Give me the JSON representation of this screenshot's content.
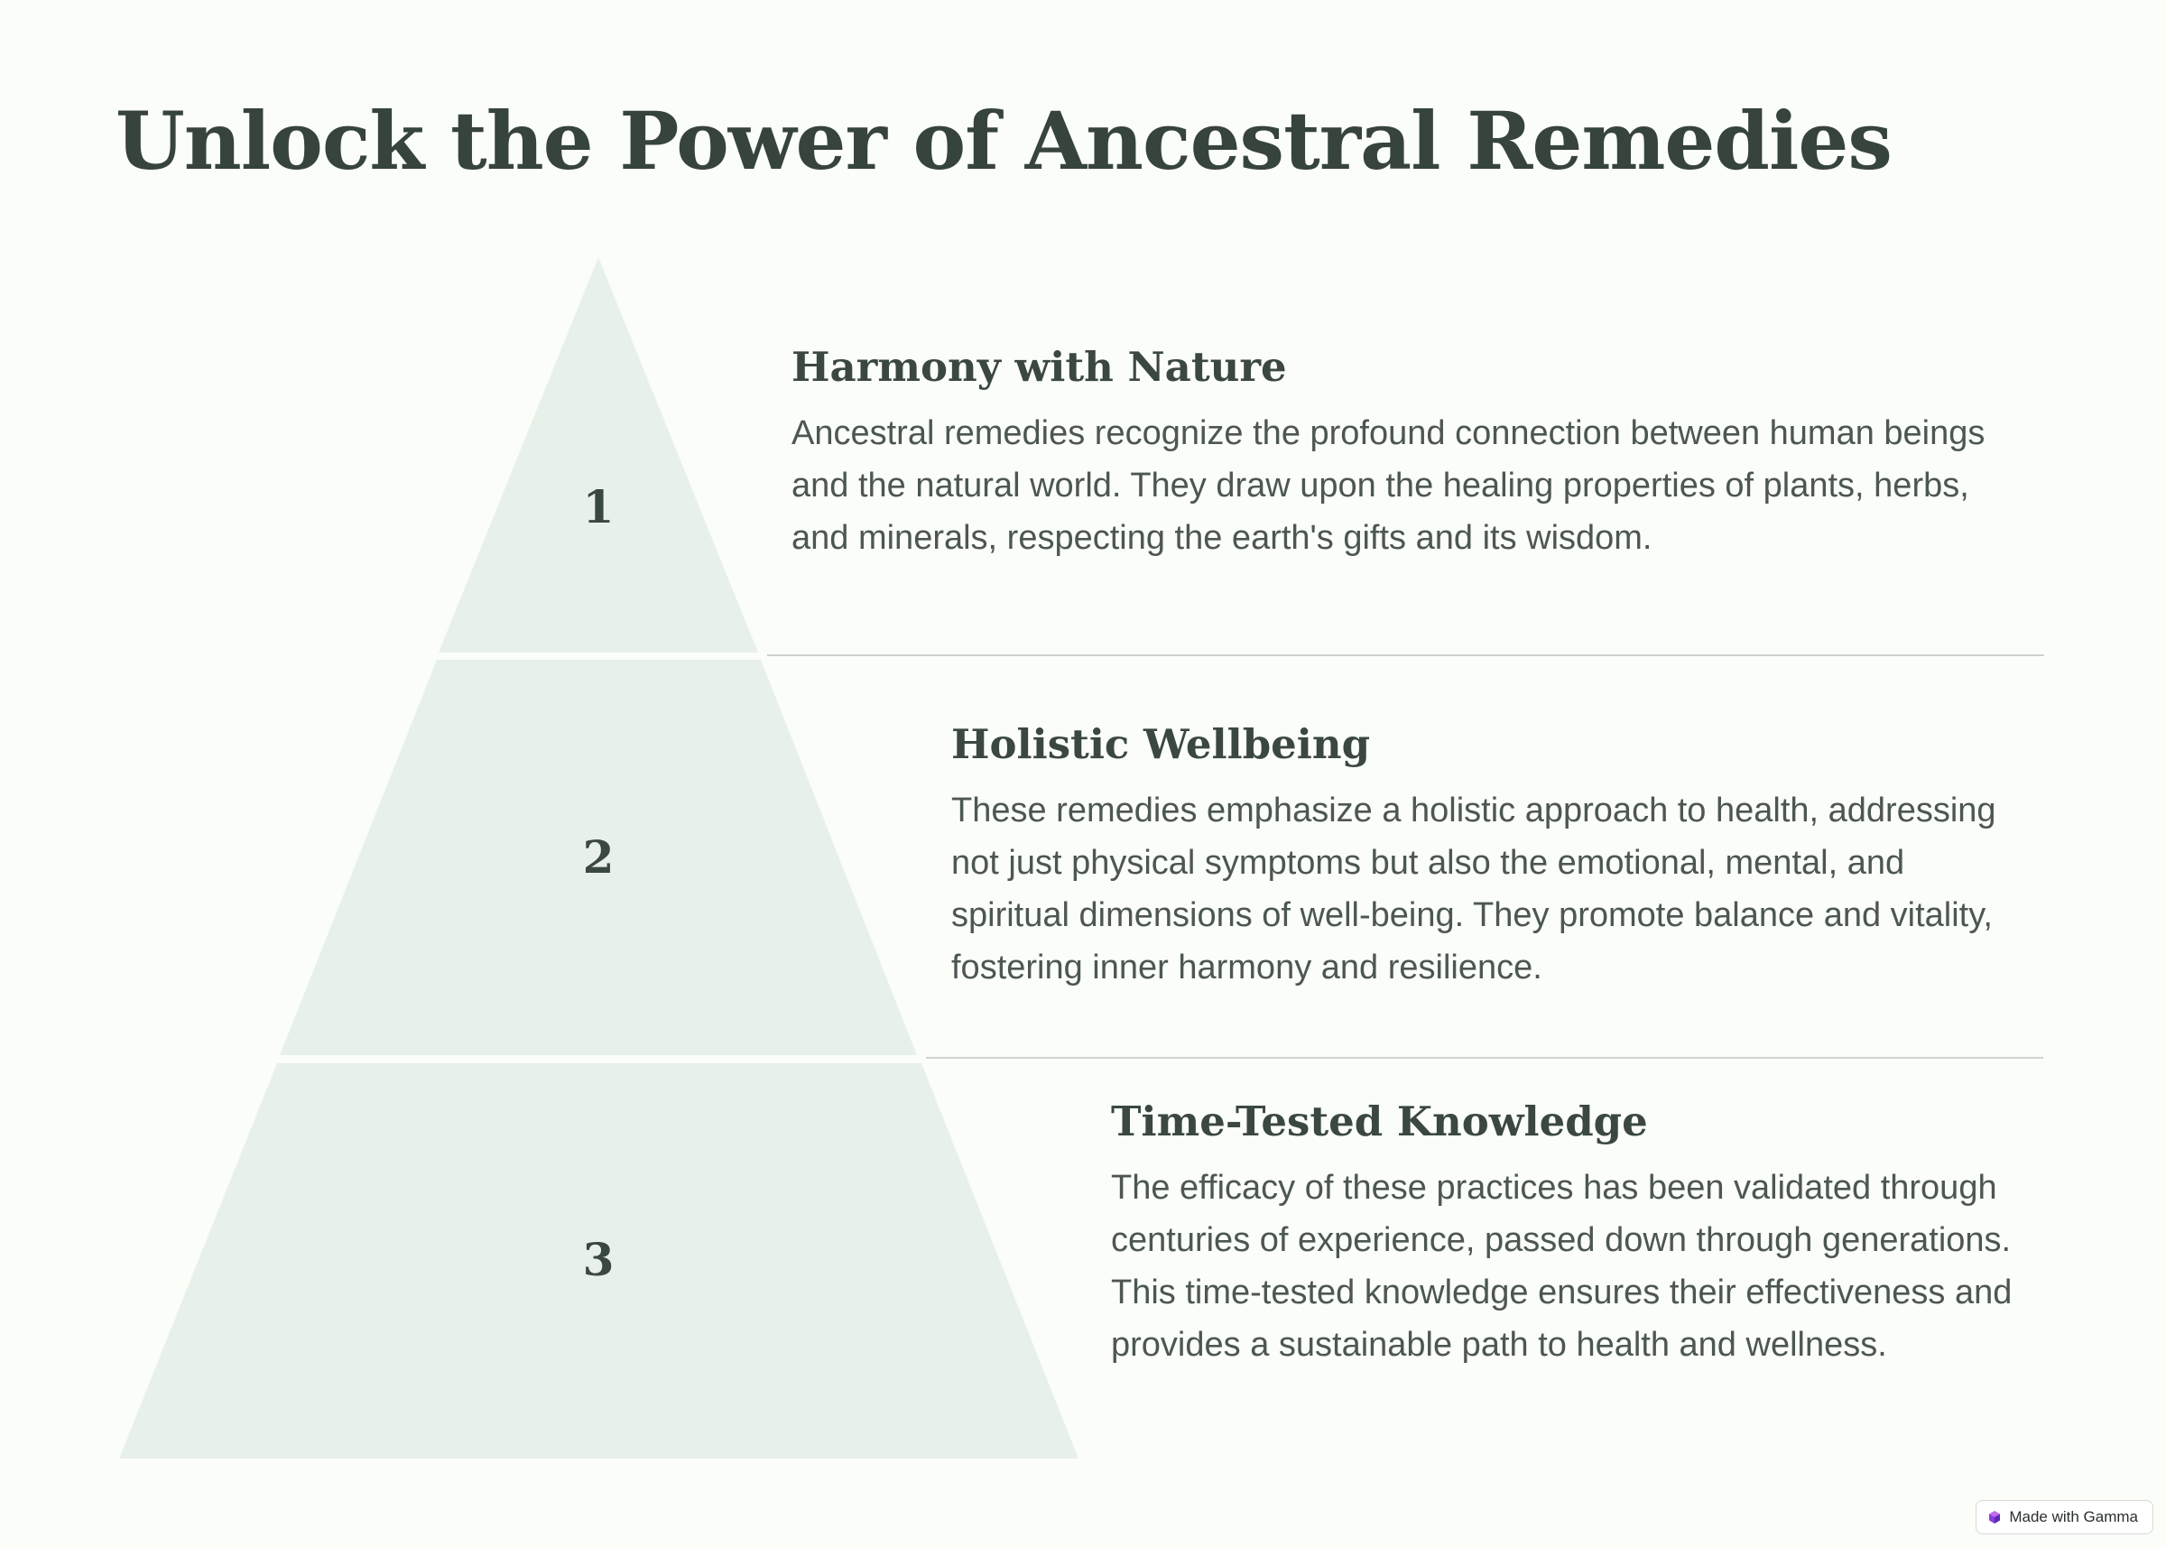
{
  "title": "Unlock the Power of Ancestral Remedies",
  "colors": {
    "background": "#fafdf8",
    "tier_fill": "#e8f1e9",
    "text": "#3b4741",
    "divider": "#cdd3cd"
  },
  "tiers": [
    {
      "number": "1",
      "heading": "Harmony with Nature",
      "body": "Ancestral remedies recognize the profound connection between human beings and the natural world. They draw upon the healing properties of plants, herbs, and minerals, respecting the earth's gifts and its wisdom."
    },
    {
      "number": "2",
      "heading": "Holistic Wellbeing",
      "body": "These remedies emphasize a holistic approach to health, addressing not just physical symptoms but also the emotional, mental, and spiritual dimensions of well-being. They promote balance and vitality, fostering inner harmony and resilience."
    },
    {
      "number": "3",
      "heading": "Time-Tested Knowledge",
      "body": "The efficacy of these practices has been validated through centuries of experience, passed down through generations. This time-tested knowledge ensures their effectiveness and provides a sustainable path to health and wellness."
    }
  ],
  "badge": {
    "label": "Made with Gamma",
    "icon": "gamma-logo-icon"
  }
}
